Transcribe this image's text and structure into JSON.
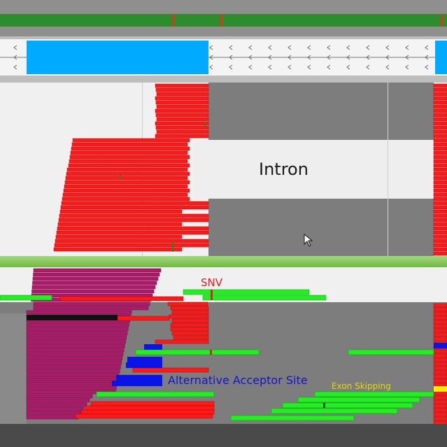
{
  "annotations": {
    "intron": "Intron",
    "snv": "SNV",
    "alternative_acceptor_site": "Alternative Acceptor Site",
    "exon_skipping": "Exon Skipping"
  },
  "icons": {
    "cursor": "mouse-pointer-icon"
  },
  "colors": {
    "read_forward": "#ff1a1a",
    "read_reverse": "#b0186a",
    "read_green": "#22ee22",
    "read_blue": "#0a14e6",
    "exon_blue": "#00aaff",
    "snv_label": "#e31a1a",
    "acceptor_label": "#1414cc",
    "exon_skipping_label": "#e6d800"
  }
}
